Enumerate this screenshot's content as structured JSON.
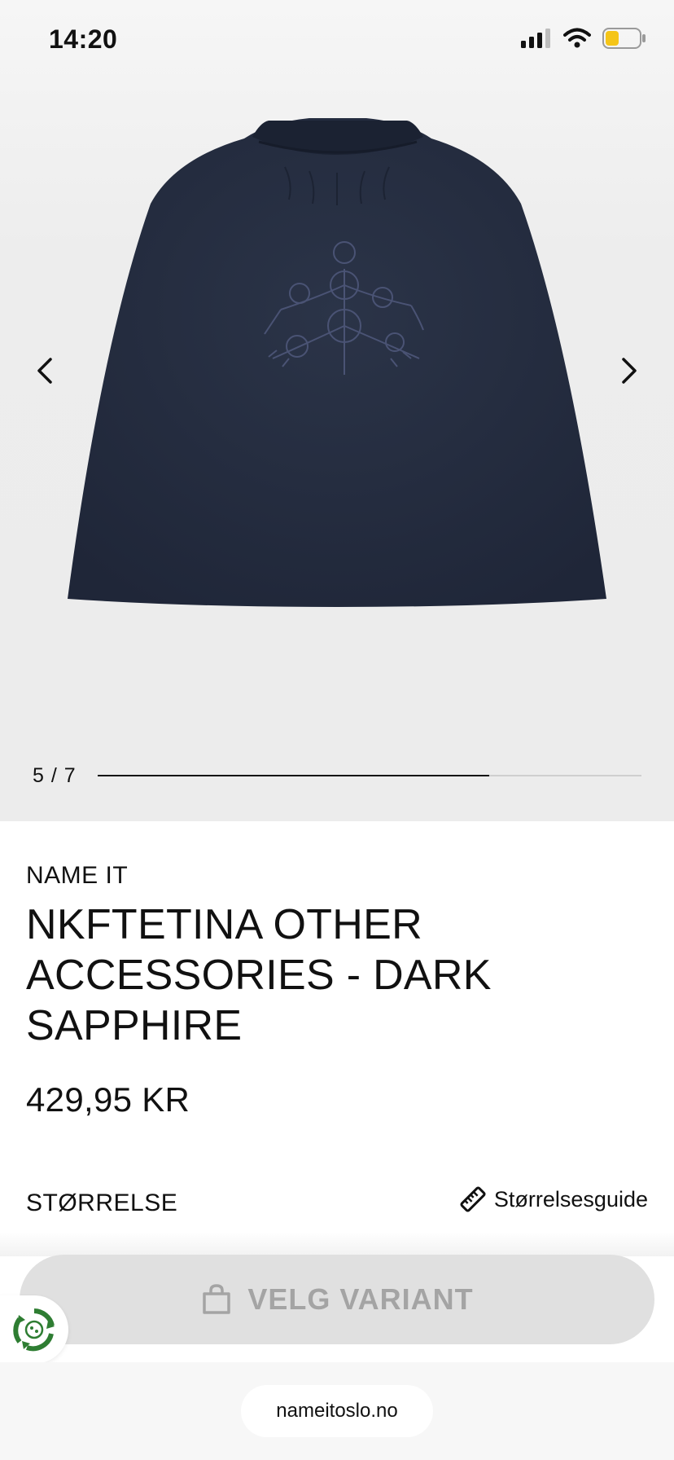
{
  "status_bar": {
    "time": "14:20",
    "icons": [
      "signal-icon",
      "wifi-icon",
      "battery-icon"
    ],
    "battery_color": "#f5c518"
  },
  "gallery": {
    "counter": "5 / 7",
    "current_slide": 5,
    "total_slides": 7,
    "progress_fraction": 0.72,
    "garment_color": "#262e42"
  },
  "product": {
    "brand": "NAME IT",
    "title": "NKFTETINA OTHER ACCESSORIES - DARK SAPPHIRE",
    "price": "429,95 KR"
  },
  "size": {
    "label": "STØRRELSE",
    "guide_label": "Størrelsesguide"
  },
  "cta": {
    "label": "VELG VARIANT",
    "background": "#e0e0e0",
    "text_color": "#a4a4a4"
  },
  "browser": {
    "url": "nameitoslo.no"
  }
}
